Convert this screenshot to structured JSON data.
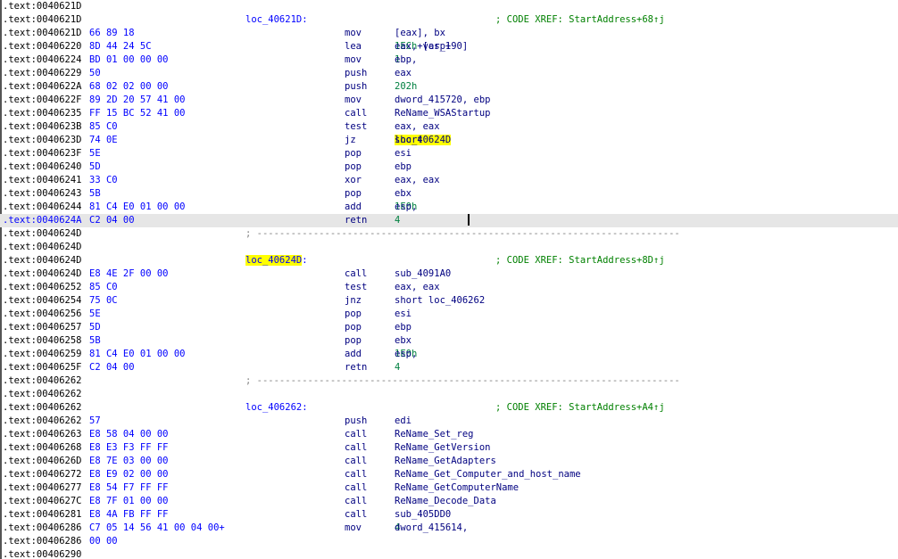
{
  "lines": [
    {
      "addr": ".text:0040621D",
      "bytes": "",
      "label": "",
      "mnemonic": "",
      "operands": [],
      "comment": ""
    },
    {
      "addr": ".text:0040621D",
      "bytes": "",
      "label": "loc_40621D:",
      "mnemonic": "",
      "operands": [],
      "comment": "; CODE XREF: StartAddress+68↑j"
    },
    {
      "addr": ".text:0040621D",
      "bytes": "66 89 18",
      "label": "",
      "mnemonic": "mov",
      "operands": [
        {
          "t": "[eax], bx"
        }
      ],
      "comment": ""
    },
    {
      "addr": ".text:00406220",
      "bytes": "8D 44 24 5C",
      "label": "",
      "mnemonic": "lea",
      "operands": [
        {
          "t": "eax, [esp+"
        },
        {
          "t": "1ECh",
          "c": "num"
        },
        {
          "t": "+var_190]"
        }
      ],
      "comment": ""
    },
    {
      "addr": ".text:00406224",
      "bytes": "BD 01 00 00 00",
      "label": "",
      "mnemonic": "mov",
      "operands": [
        {
          "t": "ebp, "
        },
        {
          "t": "1",
          "c": "num"
        }
      ],
      "comment": ""
    },
    {
      "addr": ".text:00406229",
      "bytes": "50",
      "label": "",
      "mnemonic": "push",
      "operands": [
        {
          "t": "eax"
        }
      ],
      "comment": ""
    },
    {
      "addr": ".text:0040622A",
      "bytes": "68 02 02 00 00",
      "label": "",
      "mnemonic": "push",
      "operands": [
        {
          "t": "202h",
          "c": "num"
        }
      ],
      "comment": ""
    },
    {
      "addr": ".text:0040622F",
      "bytes": "89 2D 20 57 41 00",
      "label": "",
      "mnemonic": "mov",
      "operands": [
        {
          "t": "dword_415720, ebp"
        }
      ],
      "comment": ""
    },
    {
      "addr": ".text:00406235",
      "bytes": "FF 15 BC 52 41 00",
      "label": "",
      "mnemonic": "call",
      "operands": [
        {
          "t": "ReName_WSAStartup"
        }
      ],
      "comment": ""
    },
    {
      "addr": ".text:0040623B",
      "bytes": "85 C0",
      "label": "",
      "mnemonic": "test",
      "operands": [
        {
          "t": "eax, eax"
        }
      ],
      "comment": ""
    },
    {
      "addr": ".text:0040623D",
      "bytes": "74 0E",
      "label": "",
      "mnemonic": "jz",
      "operands": [
        {
          "t": "short "
        },
        {
          "t": "loc_40624D",
          "c": "yel"
        }
      ],
      "comment": ""
    },
    {
      "addr": ".text:0040623F",
      "bytes": "5E",
      "label": "",
      "mnemonic": "pop",
      "operands": [
        {
          "t": "esi"
        }
      ],
      "comment": ""
    },
    {
      "addr": ".text:00406240",
      "bytes": "5D",
      "label": "",
      "mnemonic": "pop",
      "operands": [
        {
          "t": "ebp"
        }
      ],
      "comment": ""
    },
    {
      "addr": ".text:00406241",
      "bytes": "33 C0",
      "label": "",
      "mnemonic": "xor",
      "operands": [
        {
          "t": "eax, eax"
        }
      ],
      "comment": ""
    },
    {
      "addr": ".text:00406243",
      "bytes": "5B",
      "label": "",
      "mnemonic": "pop",
      "operands": [
        {
          "t": "ebx"
        }
      ],
      "comment": ""
    },
    {
      "addr": ".text:00406244",
      "bytes": "81 C4 E0 01 00 00",
      "label": "",
      "mnemonic": "add",
      "operands": [
        {
          "t": "esp, "
        },
        {
          "t": "1E0h",
          "c": "num"
        }
      ],
      "comment": ""
    },
    {
      "addr": ".text:0040624A",
      "bytes": "C2 04 00",
      "label": "",
      "mnemonic": "retn",
      "operands": [
        {
          "t": "4",
          "c": "num"
        }
      ],
      "comment": "",
      "highlighted": true
    },
    {
      "addr": ".text:0040624D",
      "bytes": "",
      "separator": "; ---------------------------------------------------------------------------",
      "label": "",
      "mnemonic": "",
      "operands": [],
      "comment": ""
    },
    {
      "addr": ".text:0040624D",
      "bytes": "",
      "label": "",
      "mnemonic": "",
      "operands": [],
      "comment": ""
    },
    {
      "addr": ".text:0040624D",
      "bytes": "",
      "label": "loc_40624D",
      "label_highlight": true,
      "label_suffix": ":",
      "mnemonic": "",
      "operands": [],
      "comment": "; CODE XREF: StartAddress+8D↑j"
    },
    {
      "addr": ".text:0040624D",
      "bytes": "E8 4E 2F 00 00",
      "label": "",
      "mnemonic": "call",
      "operands": [
        {
          "t": "sub_4091A0"
        }
      ],
      "comment": ""
    },
    {
      "addr": ".text:00406252",
      "bytes": "85 C0",
      "label": "",
      "mnemonic": "test",
      "operands": [
        {
          "t": "eax, eax"
        }
      ],
      "comment": ""
    },
    {
      "addr": ".text:00406254",
      "bytes": "75 0C",
      "label": "",
      "mnemonic": "jnz",
      "operands": [
        {
          "t": "short loc_406262"
        }
      ],
      "comment": ""
    },
    {
      "addr": ".text:00406256",
      "bytes": "5E",
      "label": "",
      "mnemonic": "pop",
      "operands": [
        {
          "t": "esi"
        }
      ],
      "comment": ""
    },
    {
      "addr": ".text:00406257",
      "bytes": "5D",
      "label": "",
      "mnemonic": "pop",
      "operands": [
        {
          "t": "ebp"
        }
      ],
      "comment": ""
    },
    {
      "addr": ".text:00406258",
      "bytes": "5B",
      "label": "",
      "mnemonic": "pop",
      "operands": [
        {
          "t": "ebx"
        }
      ],
      "comment": ""
    },
    {
      "addr": ".text:00406259",
      "bytes": "81 C4 E0 01 00 00",
      "label": "",
      "mnemonic": "add",
      "operands": [
        {
          "t": "esp, "
        },
        {
          "t": "1E0h",
          "c": "num"
        }
      ],
      "comment": ""
    },
    {
      "addr": ".text:0040625F",
      "bytes": "C2 04 00",
      "label": "",
      "mnemonic": "retn",
      "operands": [
        {
          "t": "4",
          "c": "num"
        }
      ],
      "comment": ""
    },
    {
      "addr": ".text:00406262",
      "bytes": "",
      "separator": "; ---------------------------------------------------------------------------",
      "label": "",
      "mnemonic": "",
      "operands": [],
      "comment": ""
    },
    {
      "addr": ".text:00406262",
      "bytes": "",
      "label": "",
      "mnemonic": "",
      "operands": [],
      "comment": ""
    },
    {
      "addr": ".text:00406262",
      "bytes": "",
      "label": "loc_406262:",
      "mnemonic": "",
      "operands": [],
      "comment": "; CODE XREF: StartAddress+A4↑j"
    },
    {
      "addr": ".text:00406262",
      "bytes": "57",
      "label": "",
      "mnemonic": "push",
      "operands": [
        {
          "t": "edi"
        }
      ],
      "comment": ""
    },
    {
      "addr": ".text:00406263",
      "bytes": "E8 58 04 00 00",
      "label": "",
      "mnemonic": "call",
      "operands": [
        {
          "t": "ReName_Set_reg"
        }
      ],
      "comment": ""
    },
    {
      "addr": ".text:00406268",
      "bytes": "E8 E3 F3 FF FF",
      "label": "",
      "mnemonic": "call",
      "operands": [
        {
          "t": "ReName_GetVersion"
        }
      ],
      "comment": ""
    },
    {
      "addr": ".text:0040626D",
      "bytes": "E8 7E 03 00 00",
      "label": "",
      "mnemonic": "call",
      "operands": [
        {
          "t": "ReName_GetAdapters"
        }
      ],
      "comment": ""
    },
    {
      "addr": ".text:00406272",
      "bytes": "E8 E9 02 00 00",
      "label": "",
      "mnemonic": "call",
      "operands": [
        {
          "t": "ReName_Get_Computer_and_host_name"
        }
      ],
      "comment": ""
    },
    {
      "addr": ".text:00406277",
      "bytes": "E8 54 F7 FF FF",
      "label": "",
      "mnemonic": "call",
      "operands": [
        {
          "t": "ReName_GetComputerName"
        }
      ],
      "comment": ""
    },
    {
      "addr": ".text:0040627C",
      "bytes": "E8 7F 01 00 00",
      "label": "",
      "mnemonic": "call",
      "operands": [
        {
          "t": "ReName_Decode_Data"
        }
      ],
      "comment": ""
    },
    {
      "addr": ".text:00406281",
      "bytes": "E8 4A FB FF FF",
      "label": "",
      "mnemonic": "call",
      "operands": [
        {
          "t": "sub_405DD0"
        }
      ],
      "comment": ""
    },
    {
      "addr": ".text:00406286",
      "bytes": "C7 05 14 56 41 00 04 00+",
      "label": "",
      "mnemonic": "mov",
      "operands": [
        {
          "t": "dword_415614, "
        },
        {
          "t": "4",
          "c": "num"
        }
      ],
      "comment": ""
    },
    {
      "addr": ".text:00406286",
      "bytes": "00 00",
      "label": "",
      "mnemonic": "",
      "operands": [],
      "comment": ""
    },
    {
      "addr": ".text:00406290",
      "bytes": "",
      "label": "",
      "mnemonic": "",
      "operands": [],
      "comment": ""
    }
  ]
}
